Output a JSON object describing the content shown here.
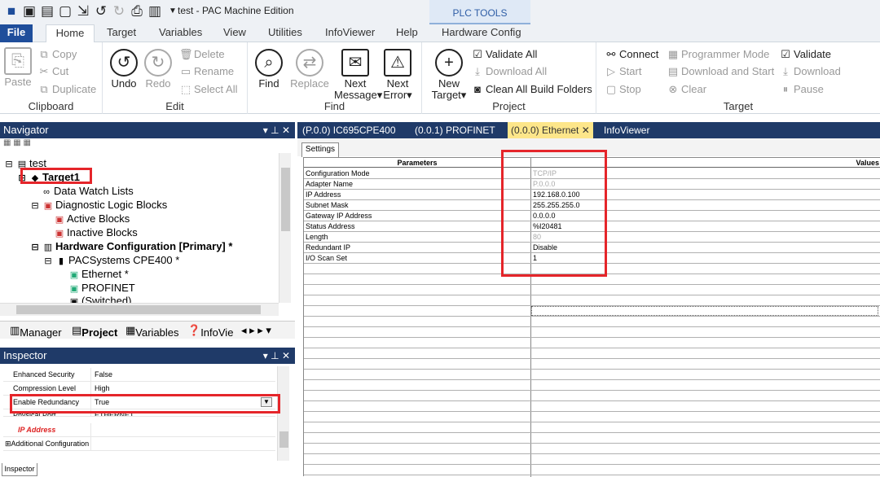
{
  "title": "test - PAC Machine Edition",
  "context_tab": "PLC TOOLS",
  "menu": [
    "File",
    "Home",
    "Target",
    "Variables",
    "View",
    "Utilities",
    "InfoViewer",
    "Help",
    "Hardware Config"
  ],
  "ribbon": {
    "clipboard": {
      "paste": "Paste",
      "copy": "Copy",
      "cut": "Cut",
      "duplicate": "Duplicate",
      "label": "Clipboard"
    },
    "edit": {
      "undo": "Undo",
      "redo": "Redo",
      "delete": "Delete",
      "rename": "Rename",
      "select_all": "Select All",
      "label": "Edit"
    },
    "find": {
      "find": "Find",
      "replace": "Replace",
      "next_message_1": "Next",
      "next_message_2": "Message",
      "next_error_1": "Next",
      "next_error_2": "Error",
      "label": "Find"
    },
    "project": {
      "new_target_1": "New",
      "new_target_2": "Target",
      "validate_all": "Validate All",
      "download_all": "Download All",
      "clean_all": "Clean All Build Folders",
      "label": "Project"
    },
    "target": {
      "connect": "Connect",
      "programmer_mode": "Programmer Mode",
      "start": "Start",
      "download_start": "Download and Start",
      "stop": "Stop",
      "clear": "Clear",
      "validate": "Validate",
      "download": "Download",
      "pause": "Pause",
      "label": "Target"
    }
  },
  "navigator": {
    "title": "Navigator",
    "tree": [
      "test",
      "Target1",
      "Data Watch Lists",
      "Diagnostic Logic Blocks",
      "Active Blocks",
      "Inactive Blocks",
      "Hardware Configuration [Primary] *",
      "PACSystems CPE400 *",
      "Ethernet *",
      "PROFINET",
      "(Switched)"
    ],
    "tabs": [
      "Manager",
      "Project",
      "Variables",
      "InfoVie"
    ]
  },
  "inspector": {
    "title": "Inspector",
    "rows": [
      {
        "key": "Enhanced Security",
        "value": "False"
      },
      {
        "key": "Compression Level",
        "value": "High"
      },
      {
        "key": "Enable Redundancy",
        "value": "True"
      },
      {
        "key": "Physical Port",
        "value": "ETHERNET"
      },
      {
        "key": "IP Address",
        "value": ""
      },
      {
        "key": "Additional Configuration",
        "value": ""
      }
    ],
    "tab": "Inspector"
  },
  "doc_tabs": [
    "(P.0.0) IC695CPE400",
    "(0.0.1) PROFINET",
    "(0.0.0) Ethernet",
    "InfoViewer"
  ],
  "settings_tab": "Settings",
  "grid": {
    "headers": [
      "Parameters",
      "Values"
    ],
    "rows": [
      {
        "param": "Configuration Mode",
        "value": "TCP/IP",
        "dim": true
      },
      {
        "param": "Adapter Name",
        "value": "P.0.0.0",
        "dim": true
      },
      {
        "param": "IP Address",
        "value": "192.168.0.100"
      },
      {
        "param": "Subnet Mask",
        "value": "255.255.255.0"
      },
      {
        "param": "Gateway IP Address",
        "value": "0.0.0.0"
      },
      {
        "param": "Status Address",
        "value": "%I20481"
      },
      {
        "param": "Length",
        "value": "80",
        "dim": true
      },
      {
        "param": "Redundant IP",
        "value": "Disable"
      },
      {
        "param": "I/O Scan Set",
        "value": "1"
      }
    ]
  },
  "colors": {
    "highlight": "#e5252a",
    "file_tab": "#1f4e9b",
    "panel_header": "#1f3a68",
    "active_doc_tab": "#fde68a"
  }
}
